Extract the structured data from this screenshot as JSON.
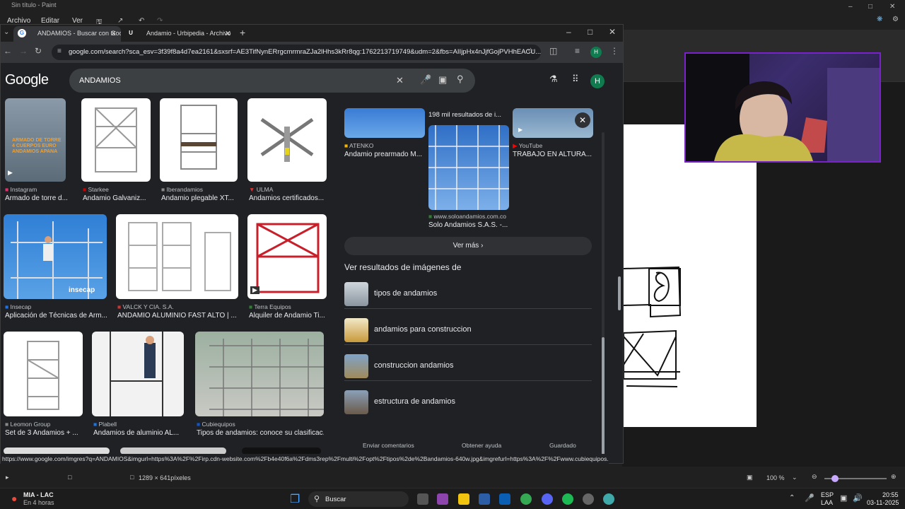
{
  "paint": {
    "title": "Sin título - Paint",
    "menu": [
      "Archivo",
      "Editar",
      "Ver"
    ],
    "status_size": "1289 × 641píxeles",
    "zoom": "100 %"
  },
  "browser": {
    "tabs": [
      {
        "label": "ANDAMIOS - Buscar con Googl",
        "icon": "google-favicon",
        "active": true
      },
      {
        "label": "Andamio - Urbipedia - Archivo",
        "icon": "urbipedia-favicon",
        "active": false
      }
    ],
    "url": "google.com/search?sca_esv=3f39f8a4d7ea2161&sxsrf=AE3TifNynERrgcmrmraZJa2lHhs3kRr8qg:1762213719749&udm=2&fbs=AIIjpHx4nJjfGojPVHhEACU...",
    "profile_initial": "H",
    "status_url": "https://www.google.com/imgres?q=ANDAMIOS&imgurl=https%3A%2F%2Firp.cdn-website.com%2Fb4e40f6a%2Fdms3rep%2Fmulti%2Fopt%2Ftipos%2de%2Bandamios-640w.jpg&imgrefurl=https%3A%2F%2Fwww.cubiequipos.com%2Festos..."
  },
  "google": {
    "logo": "Google",
    "query": "ANDAMIOS",
    "profile_initial": "H"
  },
  "results": [
    {
      "source": "Instagram",
      "caption": "Armado de torre d...",
      "video": true,
      "overlay": "ARMADO DE TORRE\n4 CUERPOS EURO\nANDAMIOS APANA"
    },
    {
      "source": "Starkee",
      "caption": "Andamio Galvaniz..."
    },
    {
      "source": "Iberandamios",
      "caption": "Andamio plegable XT..."
    },
    {
      "source": "ULMA",
      "caption": "Andamios certificados..."
    },
    {
      "source": "Insecap",
      "caption": "Aplicación de Técnicas de Arm...",
      "overlay": "insecap"
    },
    {
      "source": "VALCK Y CIA. S.A.",
      "caption": "ANDAMIO ALUMINIO FAST ALTO | ..."
    },
    {
      "source": "Terra Equipos",
      "caption": "Alquiler de Andamio Ti...",
      "video": true
    },
    {
      "source": "Leomon Group",
      "caption": "Set de 3 Andamios + ..."
    },
    {
      "source": "Plabell",
      "caption": "Andamios de aluminio AL..."
    },
    {
      "source": "Cubiequipos",
      "caption": "Tipos de andamios: conoce su clasificac..."
    }
  ],
  "right_pane": {
    "top_items": [
      {
        "source": "ATENKO",
        "caption": "Andamio prearmado M..."
      },
      {
        "source": "www.soloandamios.com.co",
        "caption": "Solo Andamios S.A.S. -..."
      },
      {
        "source": "YouTube",
        "caption": "TRABAJO EN ALTURA..."
      }
    ],
    "count_text": "198 mil resultados de i...",
    "ver_mas": "Ver más",
    "related_heading": "Ver resultados de imágenes de",
    "related": [
      "tipos de andamios",
      "andamios para construccion",
      "construccion andamios",
      "estructura de andamios"
    ],
    "footer": [
      "Enviar comentarios",
      "Obtener ayuda",
      "Guardado"
    ]
  },
  "taskbar": {
    "weather_title": "MIA - LAC",
    "weather_sub": "En 4 horas",
    "search_label": "Buscar",
    "lang": "ESP",
    "lang_sub": "LAA",
    "time": "20:55",
    "date": "03-11-2025"
  },
  "colors": {
    "accent": "#7a22c9",
    "google_bg": "#202124",
    "avatar": "#0f7b4f"
  }
}
